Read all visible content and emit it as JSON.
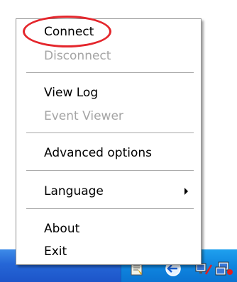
{
  "menu": {
    "items": [
      {
        "label": "Connect",
        "enabled": true
      },
      {
        "label": "Disconnect",
        "enabled": false
      },
      {
        "label": "View Log",
        "enabled": true
      },
      {
        "label": "Event Viewer",
        "enabled": false
      },
      {
        "label": "Advanced options",
        "enabled": true
      },
      {
        "label": "Language",
        "enabled": true,
        "submenu": true
      },
      {
        "label": "About",
        "enabled": true
      },
      {
        "label": "Exit",
        "enabled": true
      }
    ]
  },
  "taskbar": {
    "tray_icons": [
      "document-icon",
      "globe-arrow-icon",
      "network-icon",
      "network-alert-icon"
    ]
  },
  "colors": {
    "highlight": "#e4262c",
    "taskbar": "#2566d6",
    "tray": "#0f86df",
    "disabled_text": "#a5a5a5"
  }
}
